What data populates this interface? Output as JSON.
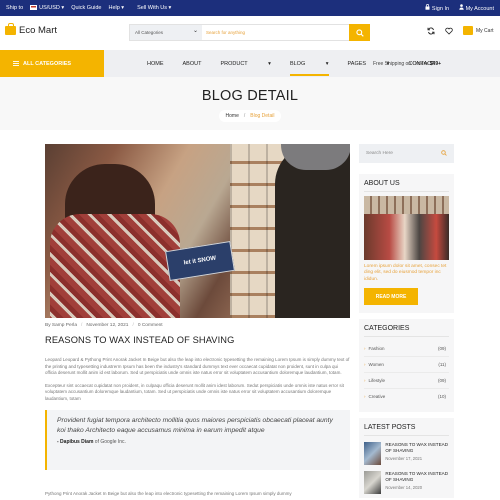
{
  "topbar": {
    "ship_to": "Ship to",
    "currency": "US/USD",
    "quick_guide": "Quick Guide",
    "help": "Help",
    "sell": "Sell With Us",
    "sign_in": "Sign In",
    "account": "My Account"
  },
  "header": {
    "logo": "Eco Mart",
    "search_category": "All Categories",
    "search_placeholder": "Search for anything",
    "cart_label": "My Cart"
  },
  "nav": {
    "all_categories": "ALL CATEGORIES",
    "items": [
      "HOME",
      "ABOUT",
      "PRODUCT",
      "BLOG",
      "PAGES",
      "CONTACT"
    ],
    "shipping_prefix": "Free Shipping on Orders",
    "shipping_amount": "$49+"
  },
  "hero": {
    "title": "BLOG DETAIL",
    "crumb_home": "Home",
    "crumb_current": "Blog Detail"
  },
  "post": {
    "author": "By Samp Perla",
    "date": "November 12, 2021",
    "comments": "0 Comment",
    "title": "REASONS TO WAX INSTEAD OF SHAVING",
    "sign_text": "let it SNOW",
    "para1": "Leopard Leopard & Pythong Print Anorak Jacket In Beige but also the leap into electronic typesetting the remaining Lorem Ipsum is simply dummy text of the printing and typesetting industrerm Ipsum has been the industry's standard dummys text ever occaecat cupidatat non proident, sunt in culpa qui officia deserunt mollit anim id est laborum. Sed ut perspiciatis unde omnis iste natus error sit voluptatem accusantium doloremque laudantium, totam.",
    "para2": "Excepteur sint occaecat cupidatat non proident, in culpaqu officia deserunt mollit anim idest laborum. Sedut perspiciatis unde omnis iste natus error sit voluptatem accusantium doloremque laudantium, totam. Sed ut perspiciatis unde omnis iste natus error sit voluptatem accusantium doloremque laudantium, totam",
    "quote": "Provident fugiat tempora architecto mollitia quos maiores perspiciatis obcaecati placeat aunty koi thako Architecto eaque accusamus minima in earum impedit atque",
    "quote_author": "- Dapibus Diam",
    "quote_source": "of Google Inc.",
    "para3": "Pythong Print Anorak Jacket In Beige but also the leap into electronic typesetting the remaining Lorem Ipsum simply dummy"
  },
  "sidebar": {
    "search_placeholder": "Search Here",
    "about_title": "ABOUT US",
    "about_text": "Lorem ipsum dolor sit amet, consec tet ding elit, sed do eiusmod tempor inc ididun.",
    "read_more": "READ MORE",
    "categories_title": "CATEGORIES",
    "categories": [
      {
        "name": "Fashion",
        "count": "(09)"
      },
      {
        "name": "Women",
        "count": "(11)"
      },
      {
        "name": "Lifestyle",
        "count": "(09)"
      },
      {
        "name": "Creative",
        "count": "(10)"
      }
    ],
    "latest_title": "LATEST POSTS",
    "latest": [
      {
        "title": "REASONS TO WAX INSTEAD OF SHAVING",
        "date": "November 17, 2021"
      },
      {
        "title": "REASONS TO WAX INSTEAD OF SHAVING",
        "date": "November 14, 2020"
      }
    ]
  },
  "colors": {
    "topbar": "#1c2f7c",
    "accent": "#f4b400",
    "link": "#e7a23b"
  }
}
